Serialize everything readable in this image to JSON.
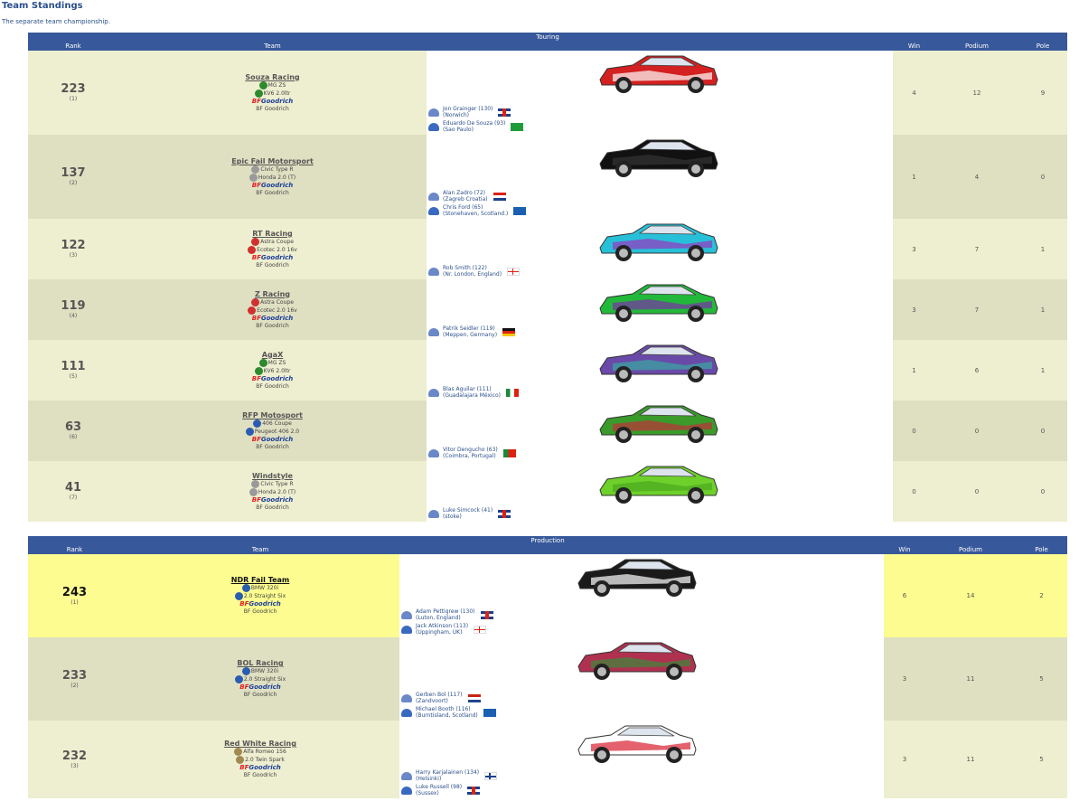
{
  "page": {
    "title": "Team Standings",
    "subtitle": "The separate team championship."
  },
  "touring": {
    "section": "Touring",
    "columns": {
      "rank": "Rank",
      "team": "Team",
      "win": "Win",
      "podium": "Podium",
      "pole": "Pole"
    },
    "rows": [
      {
        "rank": "223",
        "pos": "(1)",
        "team": "Souza Racing",
        "car_model": "MG ZS",
        "engine": "KV6 2.0ltr",
        "tyres": "BF Goodrich",
        "brand_color": "#2c8a2c",
        "car_colors": [
          "#d32020",
          "#ffffff"
        ],
        "drivers": [
          {
            "name": "Jon Grainger (130)",
            "location": "(Norwich)",
            "flag": "uk"
          },
          {
            "name": "Eduardo De Souza (93)",
            "location": "(Sao Paulo)",
            "flag": "br"
          }
        ],
        "win": "4",
        "podium": "12",
        "pole": "9"
      },
      {
        "rank": "137",
        "pos": "(2)",
        "team": "Epic Fail Motorsport",
        "car_model": "Civic Type R",
        "engine": "Honda 2.0 (T)",
        "tyres": "BF Goodrich",
        "brand_color": "#9a9a9a",
        "car_colors": [
          "#111111",
          "#333333"
        ],
        "drivers": [
          {
            "name": "Alan Zadro (72)",
            "location": "(Zagreb Croatia)",
            "flag": "hr"
          },
          {
            "name": "Chris Ford (65)",
            "location": "(Stonehaven, Scotland.)",
            "flag": "sco"
          }
        ],
        "win": "1",
        "podium": "4",
        "pole": "0"
      },
      {
        "rank": "122",
        "pos": "(3)",
        "team": "RT Racing",
        "car_model": "Astra Coupe",
        "engine": "Ecotec 2.0 16v",
        "tyres": "BF Goodrich",
        "brand_color": "#d03030",
        "car_colors": [
          "#27c0d8",
          "#9b35c0"
        ],
        "drivers": [
          {
            "name": "Rob Smith (122)",
            "location": "(Nr. London, England)",
            "flag": "eng"
          }
        ],
        "win": "3",
        "podium": "7",
        "pole": "1"
      },
      {
        "rank": "119",
        "pos": "(4)",
        "team": "Z Racing",
        "car_model": "Astra Coupe",
        "engine": "Ecotec 2.0 16v",
        "tyres": "BF Goodrich",
        "brand_color": "#d03030",
        "car_colors": [
          "#22b83a",
          "#7a30a8"
        ],
        "drivers": [
          {
            "name": "Patrik Seidler (119)",
            "location": "(Meppen, Germany)",
            "flag": "de"
          }
        ],
        "win": "3",
        "podium": "7",
        "pole": "1"
      },
      {
        "rank": "111",
        "pos": "(5)",
        "team": "AgaX",
        "car_model": "MG ZS",
        "engine": "KV6 2.0ltr",
        "tyres": "BF Goodrich",
        "brand_color": "#2c8a2c",
        "car_colors": [
          "#6a4aa8",
          "#38a8a0"
        ],
        "drivers": [
          {
            "name": "Blas Aguilar (111)",
            "location": "(Guadalajara México)",
            "flag": "mx"
          }
        ],
        "win": "1",
        "podium": "6",
        "pole": "1"
      },
      {
        "rank": "63",
        "pos": "(6)",
        "team": "RFP Motosport",
        "car_model": "406 Coupe",
        "engine": "Peugeot 406 2.0",
        "tyres": "BF Goodrich",
        "brand_color": "#2a5db0",
        "car_colors": [
          "#3a9a2a",
          "#c0303a"
        ],
        "drivers": [
          {
            "name": "Vitor Dengucho (63)",
            "location": "(Coimbra, Portugal)",
            "flag": "pt"
          }
        ],
        "win": "0",
        "podium": "0",
        "pole": "0"
      },
      {
        "rank": "41",
        "pos": "(7)",
        "team": "Windstyle",
        "car_model": "Civic Type R",
        "engine": "Honda 2.0 (T)",
        "tyres": "BF Goodrich",
        "brand_color": "#9a9a9a",
        "car_colors": [
          "#6ed02a",
          "#4aa81e"
        ],
        "drivers": [
          {
            "name": "Luke Simcock (41)",
            "location": "(stoke)",
            "flag": "uk"
          }
        ],
        "win": "0",
        "podium": "0",
        "pole": "0"
      }
    ]
  },
  "production": {
    "section": "Production",
    "columns": {
      "rank": "Rank",
      "team": "Team",
      "win": "Win",
      "podium": "Podium",
      "pole": "Pole"
    },
    "rows": [
      {
        "rank": "243",
        "pos": "(1)",
        "team": "NDR Fail Team",
        "car_model": "BMW 320i",
        "engine": "2.0 Straight Six",
        "tyres": "BF Goodrich",
        "brand_color": "#2a5db0",
        "car_colors": [
          "#1a1a1a",
          "#ffffff"
        ],
        "drivers": [
          {
            "name": "Adam Pettigrew (130)",
            "location": "(Luton, England)",
            "flag": "uk"
          },
          {
            "name": "Jack Atkinson (113)",
            "location": "(Uppingham, UK)",
            "flag": "eng"
          }
        ],
        "win": "6",
        "podium": "14",
        "pole": "2"
      },
      {
        "rank": "233",
        "pos": "(2)",
        "team": "BOL Racing",
        "car_model": "BMW 320i",
        "engine": "2.0 Straight Six",
        "tyres": "BF Goodrich",
        "brand_color": "#2a5db0",
        "car_colors": [
          "#b03050",
          "#3a8a3a"
        ],
        "drivers": [
          {
            "name": "Gerben Bol (117)",
            "location": "(Zandvoort)",
            "flag": "nl"
          },
          {
            "name": "Michael Booth (116)",
            "location": "(Burntisland, Scotland)",
            "flag": "sco"
          }
        ],
        "win": "3",
        "podium": "11",
        "pole": "5"
      },
      {
        "rank": "232",
        "pos": "(3)",
        "team": "Red White Racing",
        "car_model": "Alfa Romeo 156",
        "engine": "2.0 Twin Spark",
        "tyres": "BF Goodrich",
        "brand_color": "#a08a50",
        "car_colors": [
          "#ffffff",
          "#d82030"
        ],
        "drivers": [
          {
            "name": "Harry Karjalainen (134)",
            "location": "(Helsinki)",
            "flag": "fi"
          },
          {
            "name": "Luke Russell (98)",
            "location": "(Sussex)",
            "flag": "uk"
          }
        ],
        "win": "3",
        "podium": "11",
        "pole": "5"
      }
    ]
  }
}
